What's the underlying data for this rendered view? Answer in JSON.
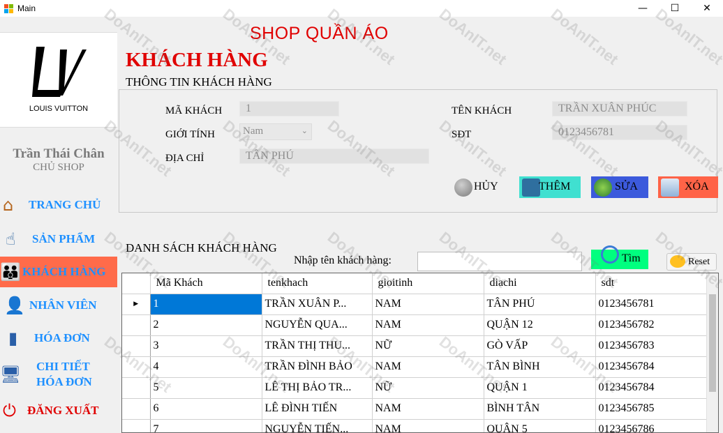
{
  "window": {
    "title": "Main",
    "min": "—",
    "max": "☐",
    "close": "✕"
  },
  "sidebar": {
    "brand": "LOUIS VUITTON",
    "user_name": "Trần Thái Chân",
    "user_role": "CHỦ SHOP",
    "items": [
      {
        "label": "TRANG CHỦ",
        "icon": "home-icon"
      },
      {
        "label": "SẢN PHẨM",
        "icon": "product-hand-icon"
      },
      {
        "label": "KHÁCH HÀNG",
        "icon": "customers-icon"
      },
      {
        "label": "NHÂN VIÊN",
        "icon": "employee-icon"
      },
      {
        "label": "HÓA ĐƠN",
        "icon": "invoice-icon"
      },
      {
        "label": "CHI TIẾT HÓA ĐƠN",
        "line1": "CHI TIẾT",
        "line2": "HÓA ĐƠN",
        "icon": "monitor-icon"
      },
      {
        "label": "ĐĂNG XUẤT",
        "icon": "power-icon"
      }
    ]
  },
  "header": {
    "shop_title": "SHOP QUẦN ÁO",
    "page_title": "KHÁCH HÀNG"
  },
  "info": {
    "section_title": "THÔNG TIN KHÁCH HÀNG",
    "ma_khach_label": "MÃ KHÁCH",
    "ma_khach_value": "1",
    "gioi_tinh_label": "GIỚI TÍNH",
    "gioi_tinh_value": "Nam",
    "dia_chi_label": "ĐỊA CHỈ",
    "dia_chi_value": "TÂN PHÚ",
    "ten_khach_label": "TÊN KHÁCH",
    "ten_khach_value": "TRẦN XUÂN PHÚC",
    "sdt_label": "SĐT",
    "sdt_value": "0123456781"
  },
  "buttons": {
    "huy": "HỦY",
    "them": "THÊM",
    "sua": "SỬA",
    "xoa": "XÓA"
  },
  "colors": {
    "accent_red": "#e00000",
    "nav_blue": "#1e90ff",
    "active_bg": "#ff6b4a",
    "them_bg": "#40e0d0",
    "sua_bg": "#3c5adc",
    "xoa_bg": "#ff6347",
    "tim_bg": "#00ff7f",
    "selected": "#0078d7"
  },
  "list": {
    "section_title": "DANH SÁCH KHÁCH HÀNG",
    "search_label": "Nhập tên khách hàng:",
    "search_value": "",
    "search_button": "Tìm",
    "reset_button": "Reset",
    "columns": [
      "Mã Khách",
      "tenkhach",
      "gioitinh",
      "diachi",
      "sdt"
    ],
    "rows": [
      [
        "1",
        "TRẦN XUÂN P...",
        "NAM",
        "TÂN PHÚ",
        "0123456781"
      ],
      [
        "2",
        "NGUYỄN QUA...",
        "NAM",
        "QUẬN 12",
        "0123456782"
      ],
      [
        "3",
        "TRẦN THỊ THU...",
        "NỮ",
        "GÒ VẤP",
        "0123456783"
      ],
      [
        "4",
        "TRẦN ĐÌNH BẢO",
        "NAM",
        "TÂN BÌNH",
        "0123456784"
      ],
      [
        "5",
        "LÊ THỊ BẢO TR...",
        "NỮ",
        "QUẬN 1",
        "0123456784"
      ],
      [
        "6",
        "LÊ ĐÌNH TIẾN",
        "NAM",
        "BÌNH TÂN",
        "0123456785"
      ],
      [
        "7",
        "NGUYỄN TIẾN...",
        "NAM",
        "QUẬN 5",
        "0123456786"
      ]
    ]
  },
  "watermark": "DoAnIT.net"
}
